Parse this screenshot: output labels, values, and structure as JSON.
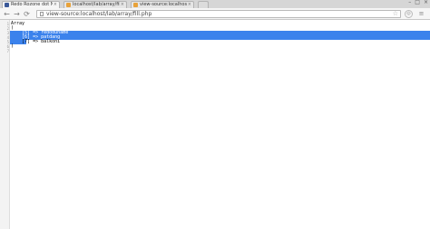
{
  "tabs": [
    {
      "title": "Redo Rozone dot Net",
      "close": "×",
      "favicon_color": "#3b5998"
    },
    {
      "title": "localhost/lab/array/fill.php",
      "close": "×",
      "favicon_color": "#e8a23a"
    },
    {
      "title": "view-source:localhost/lab/",
      "close": "×",
      "favicon_color": "#e8a23a"
    }
  ],
  "window_controls": {
    "minimize": "–",
    "maximize": "□",
    "close": "×"
  },
  "toolbar": {
    "back": "←",
    "forward": "→",
    "reload": "⟳",
    "url": "view-source:localhost/lab/array/fill.php",
    "star": "☆",
    "extension": "◎",
    "menu": "≡"
  },
  "source": {
    "line_numbers": [
      "1",
      "2",
      "3",
      "4",
      "5",
      "6",
      "7"
    ],
    "lines": [
      "Array",
      "(",
      "    [5] => redoduname",
      "    [6] => patdang",
      "    [7] => balkoni",
      ")",
      ""
    ]
  },
  "colors": {
    "selection": "#3b82ec",
    "gutter": "#f3f3f3"
  }
}
